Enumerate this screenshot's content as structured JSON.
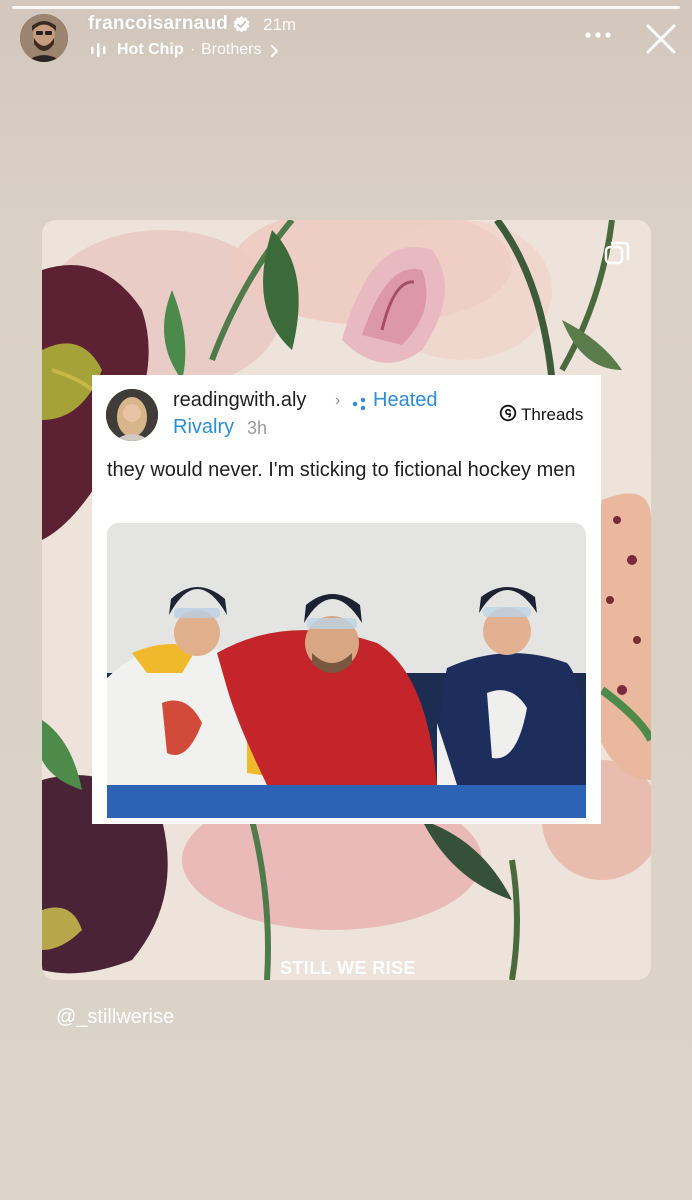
{
  "story": {
    "username": "francoisarnaud",
    "time_ago": "21m",
    "music_song": "Hot Chip",
    "music_separator": "·",
    "music_title": "Brothers",
    "mention": "@_stillwerise"
  },
  "post": {
    "username": "readingwith.aly",
    "arrow": "›",
    "tag_line1": "Heated",
    "tag_line2": "Rivalry",
    "time_ago": "3h",
    "source_label": "Threads",
    "text": "they would never. I'm sticking to fictional hockey men"
  },
  "card": {
    "watermark": "STILL WE RISE"
  },
  "icons": {
    "verified": "verified-badge-icon",
    "music": "music-equalizer-icon",
    "chevron": "chevron-right-icon",
    "more": "more-options-icon",
    "close": "close-icon",
    "repost": "repost-icon",
    "threads": "threads-logo-icon"
  },
  "colors": {
    "tag_blue": "#2b8ed6",
    "background": "#dcd4c9"
  }
}
